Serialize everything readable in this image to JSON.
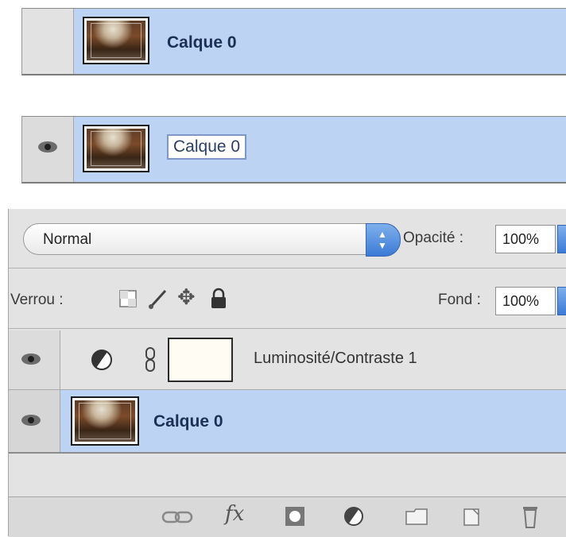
{
  "layer_rows": [
    {
      "name": "Calque 0",
      "visible": false,
      "editing": false
    },
    {
      "name": "Calque 0",
      "visible": true,
      "editing": true
    }
  ],
  "panel": {
    "blend_mode": "Normal",
    "opacity_label": "Opacité :",
    "opacity_value": "100%",
    "lock_label": "Verrou :",
    "fill_label": "Fond :",
    "fill_value": "100%",
    "layers": [
      {
        "name": "Luminosité/Contraste 1",
        "type": "adjustment",
        "visible": true
      },
      {
        "name": "Calque 0",
        "type": "image",
        "visible": true,
        "selected": true
      }
    ],
    "footer_icons": [
      "link-icon",
      "fx-icon",
      "mask-icon",
      "adjustment-icon",
      "folder-icon",
      "new-layer-icon",
      "trash-icon"
    ],
    "fx_text": "fx"
  },
  "colors": {
    "selection": "#bcd3f4",
    "panel_bg": "#e3e3e3",
    "accent": "#3b7ad6"
  }
}
